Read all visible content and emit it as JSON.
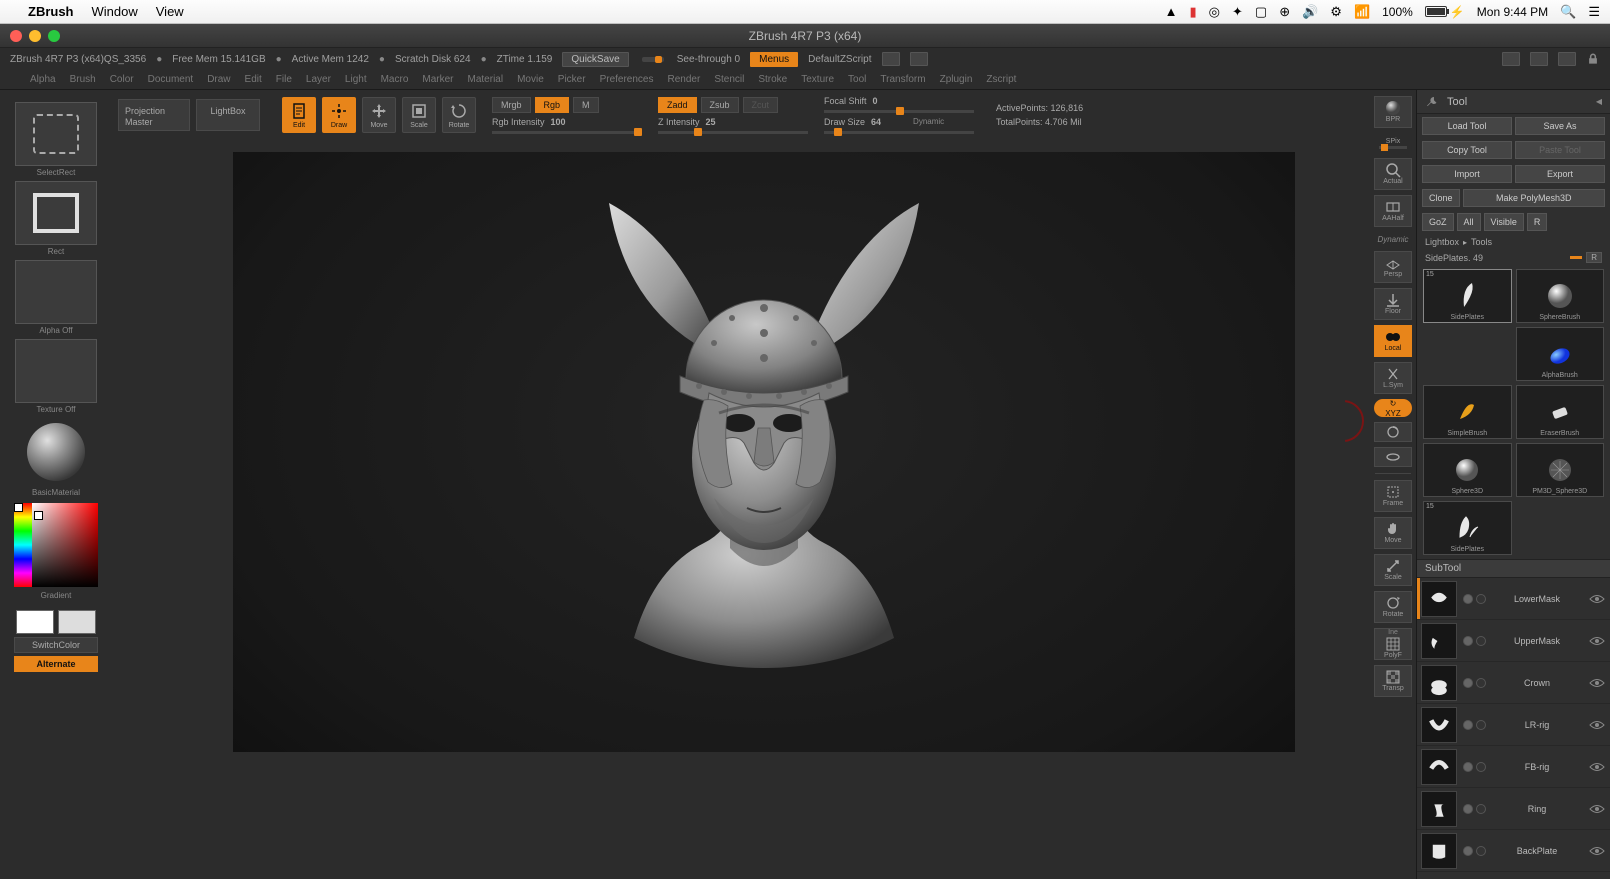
{
  "macbar": {
    "app": "ZBrush",
    "menus": [
      "Window",
      "View"
    ],
    "battery_pct": "100%",
    "charge_label": "⚡",
    "clock": "Mon 9:44 PM"
  },
  "window": {
    "title": "ZBrush 4R7 P3 (x64)"
  },
  "inforow": {
    "version": "ZBrush 4R7 P3 (x64)QS_3356",
    "freemem": "Free Mem 15.141GB",
    "activemem": "Active Mem 1242",
    "scratch": "Scratch Disk 624",
    "ztime": "ZTime 1.159",
    "quicksave": "QuickSave",
    "seethrough": "See-through  0",
    "menus": "Menus",
    "zscript": "DefaultZScript"
  },
  "menurow": [
    "Alpha",
    "Brush",
    "Color",
    "Document",
    "Draw",
    "Edit",
    "File",
    "Layer",
    "Light",
    "Macro",
    "Marker",
    "Material",
    "Movie",
    "Picker",
    "Preferences",
    "Render",
    "Stencil",
    "Stroke",
    "Texture",
    "Tool",
    "Transform",
    "Zplugin",
    "Zscript"
  ],
  "toolrow": {
    "projection_master": "Projection Master",
    "lightbox": "LightBox",
    "gizmo": [
      {
        "label": "Edit",
        "active": true,
        "icon": "edit"
      },
      {
        "label": "Draw",
        "active": true,
        "icon": "draw"
      },
      {
        "label": "Move",
        "active": false,
        "icon": "move"
      },
      {
        "label": "Scale",
        "active": false,
        "icon": "scale"
      },
      {
        "label": "Rotate",
        "active": false,
        "icon": "rotate"
      }
    ],
    "colormode": [
      {
        "l": "Mrgb",
        "a": false
      },
      {
        "l": "Rgb",
        "a": true
      },
      {
        "l": "M",
        "a": false
      }
    ],
    "zmode": [
      {
        "l": "Zadd",
        "a": true
      },
      {
        "l": "Zsub",
        "a": false
      },
      {
        "l": "Zcut",
        "a": false,
        "dim": true
      }
    ],
    "rgb_intensity_label": "Rgb Intensity",
    "rgb_intensity_val": "100",
    "z_intensity_label": "Z Intensity",
    "z_intensity_val": "25",
    "focal_label": "Focal Shift",
    "focal_val": "0",
    "drawsize_label": "Draw Size",
    "drawsize_val": "64",
    "dynamic": "Dynamic",
    "activepoints_label": "ActivePoints:",
    "activepoints_val": "126,816",
    "totalpoints_label": "TotalPoints:",
    "totalpoints_val": "4.706 Mil"
  },
  "leftshelf": {
    "selectrect": "SelectRect",
    "rect": "Rect",
    "alpha": "Alpha Off",
    "texture": "Texture Off",
    "material": "BasicMaterial",
    "gradient": "Gradient",
    "switchcolor": "SwitchColor",
    "alternate": "Alternate"
  },
  "rightnav": [
    {
      "l": "BPR",
      "icon": "sphere"
    },
    {
      "l": "SPix",
      "icon": "line",
      "orange": true,
      "short": true
    },
    {
      "l": "Actual",
      "icon": "zoom1"
    },
    {
      "l": "AAHalf",
      "icon": "zoomhalf"
    },
    {
      "l": "Dynamic",
      "str": true
    },
    {
      "l": "Persp",
      "icon": "grid"
    },
    {
      "l": "Floor",
      "icon": "arrowdown"
    },
    {
      "l": "Local",
      "icon": "local",
      "active": true
    },
    {
      "l": "L.Sym",
      "icon": "lsym"
    },
    {
      "l": "XYZ",
      "pill": true,
      "active": true,
      "icon": "xyz"
    },
    {
      "l": "",
      "icon": "rot1"
    },
    {
      "l": "",
      "icon": "rot2"
    },
    {
      "l": "Frame",
      "icon": "frame"
    },
    {
      "l": "Move",
      "icon": "hand"
    },
    {
      "l": "Scale",
      "icon": "scaleicon"
    },
    {
      "l": "Rotate",
      "icon": "rotateicon"
    },
    {
      "l": "PolyF",
      "icon": "polyf"
    },
    {
      "l": "Transp",
      "icon": "transp"
    }
  ],
  "toolpanel": {
    "header": "Tool",
    "buttons1": [
      {
        "l": "Load Tool"
      },
      {
        "l": "Save As"
      }
    ],
    "buttons2": [
      {
        "l": "Copy Tool"
      },
      {
        "l": "Paste Tool",
        "dis": true
      }
    ],
    "buttons3": [
      {
        "l": "Import"
      },
      {
        "l": "Export"
      }
    ],
    "buttons4": [
      {
        "l": "Clone"
      },
      {
        "l": "Make PolyMesh3D"
      }
    ],
    "buttons5": [
      {
        "l": "GoZ"
      },
      {
        "l": "All"
      },
      {
        "l": "Visible"
      },
      {
        "l": "R"
      }
    ],
    "breadcrumb_a": "Lightbox",
    "breadcrumb_b": "Tools",
    "toolname": "SidePlates. 49",
    "r": "R",
    "thumbs": [
      {
        "label": "SidePlates",
        "count": "15",
        "sel": true,
        "icon": "horn"
      },
      {
        "label": "SphereBrush",
        "icon": "sphereb"
      },
      {
        "label": "AlphaBrush",
        "icon": "alphab"
      },
      {
        "label": "SimpleBrush",
        "icon": "simpleb"
      },
      {
        "label": "EraserBrush",
        "icon": "eraser"
      },
      {
        "label": "Sphere3D",
        "icon": "sphere3d"
      },
      {
        "label": "PM3D_Sphere3D",
        "icon": "pm3d"
      },
      {
        "label": "SidePlates",
        "count": "15",
        "icon": "horn2"
      }
    ],
    "subtool_header": "SubTool",
    "subtools": [
      {
        "name": "LowerMask",
        "icon": "lower",
        "active": true
      },
      {
        "name": "UpperMask",
        "icon": "upper"
      },
      {
        "name": "Crown",
        "icon": "crown"
      },
      {
        "name": "LR-rig",
        "icon": "lrrig"
      },
      {
        "name": "FB-rig",
        "icon": "fbrig"
      },
      {
        "name": "Ring",
        "icon": "ring"
      },
      {
        "name": "BackPlate",
        "icon": "back"
      }
    ]
  }
}
